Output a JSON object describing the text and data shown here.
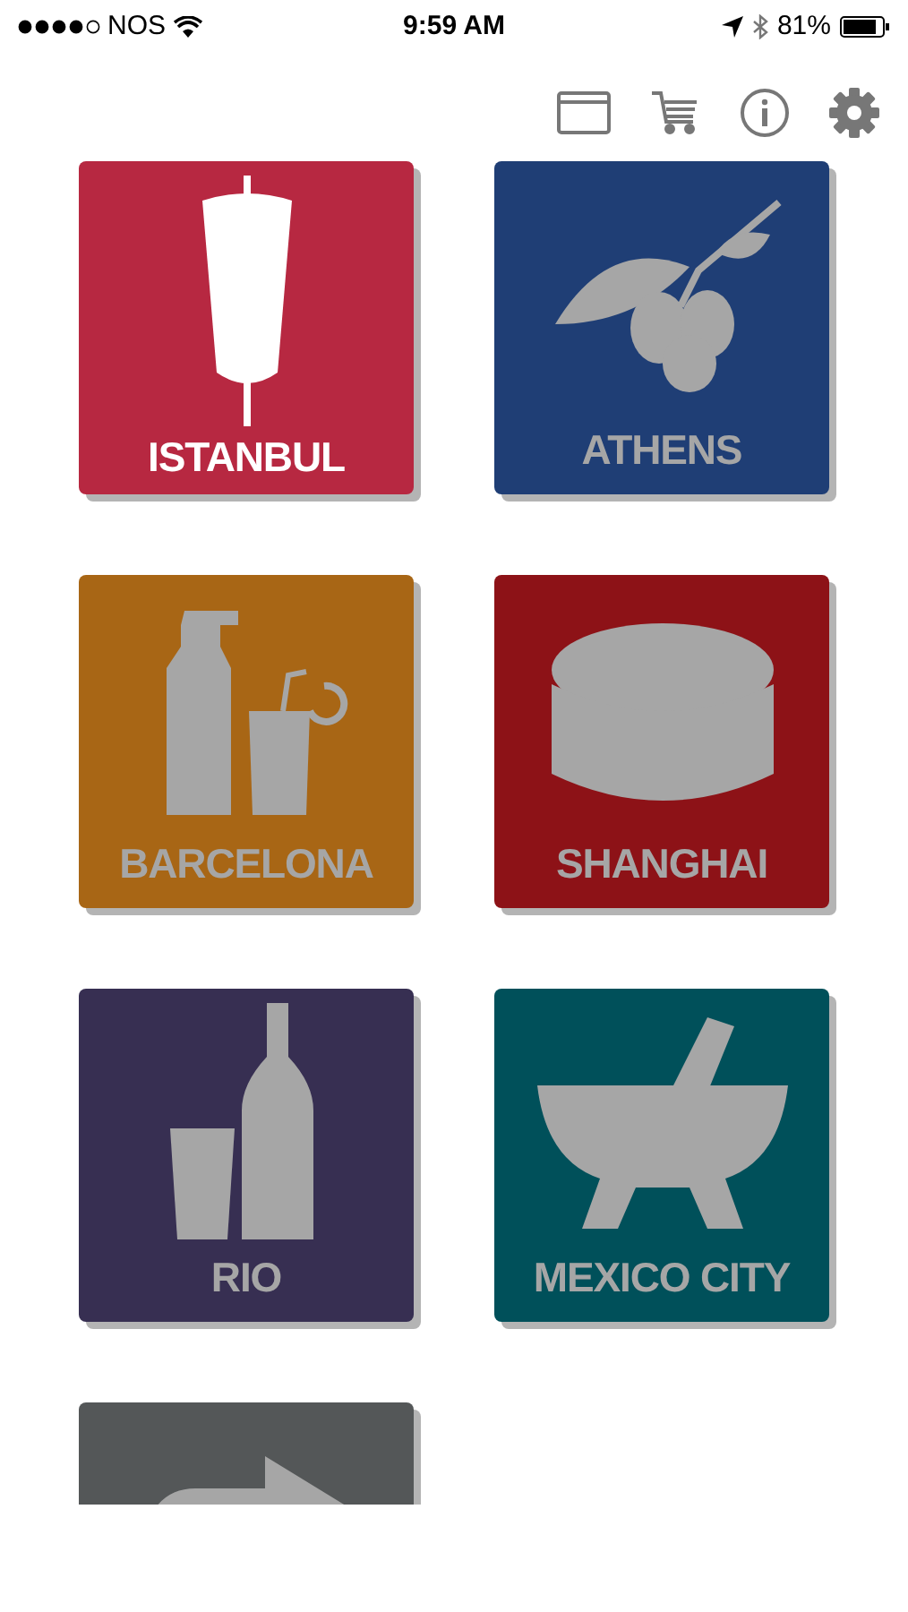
{
  "status_bar": {
    "carrier": "NOS",
    "time": "9:59 AM",
    "battery": "81%"
  },
  "tiles": [
    {
      "label": "ISTANBUL",
      "color": "#b72841",
      "kind": "doner",
      "selected": true
    },
    {
      "label": "ATHENS",
      "color": "#1f3e75",
      "kind": "olives",
      "selected": false
    },
    {
      "label": "BARCELONA",
      "color": "#a86615",
      "kind": "bottles",
      "selected": false
    },
    {
      "label": "SHANGHAI",
      "color": "#8d1217",
      "kind": "dumplings",
      "selected": false
    },
    {
      "label": "RIO",
      "color": "#372f52",
      "kind": "beer",
      "selected": false
    },
    {
      "label": "MEXICO CITY",
      "color": "#00505a",
      "kind": "mortar",
      "selected": false
    },
    {
      "color": "#545758",
      "kind": "arrow",
      "selected": false
    }
  ]
}
